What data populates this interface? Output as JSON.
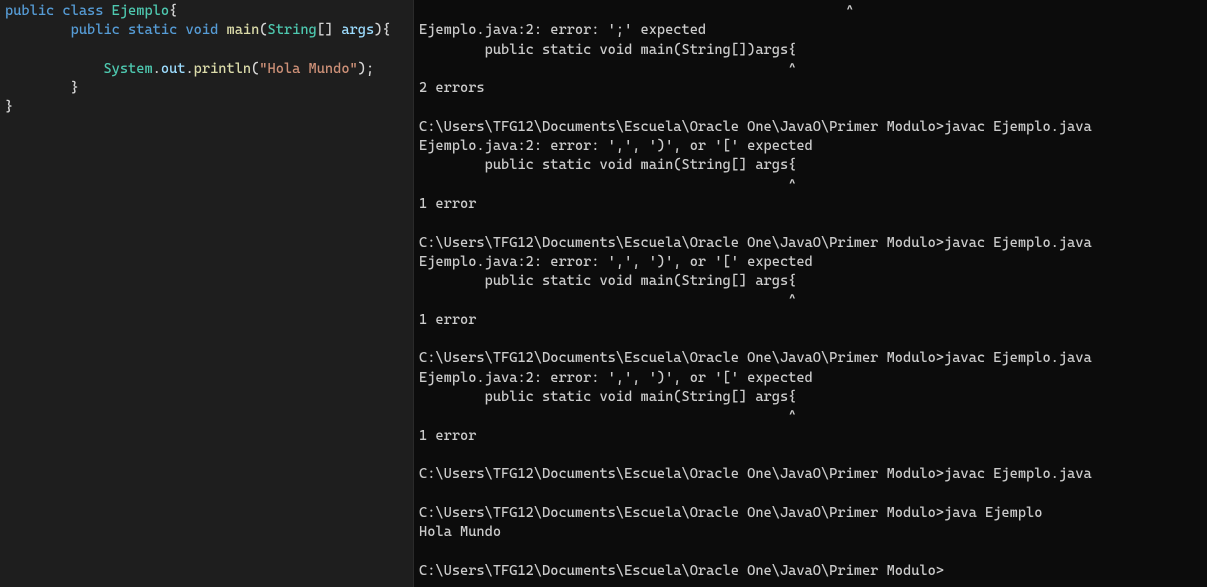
{
  "editor": {
    "tokens": [
      {
        "c": "kw",
        "t": "public"
      },
      {
        "c": "pun",
        "t": " "
      },
      {
        "c": "kw",
        "t": "class"
      },
      {
        "c": "pun",
        "t": " "
      },
      {
        "c": "cls",
        "t": "Ejemplo"
      },
      {
        "c": "pun",
        "t": "{\n"
      },
      {
        "c": "pun",
        "t": "        "
      },
      {
        "c": "kw",
        "t": "public"
      },
      {
        "c": "pun",
        "t": " "
      },
      {
        "c": "kw",
        "t": "static"
      },
      {
        "c": "pun",
        "t": " "
      },
      {
        "c": "kw",
        "t": "void"
      },
      {
        "c": "pun",
        "t": " "
      },
      {
        "c": "fn",
        "t": "main"
      },
      {
        "c": "pun",
        "t": "("
      },
      {
        "c": "type",
        "t": "String"
      },
      {
        "c": "pun",
        "t": "[] "
      },
      {
        "c": "id",
        "t": "args"
      },
      {
        "c": "pun",
        "t": "){\n"
      },
      {
        "c": "pun",
        "t": "\n"
      },
      {
        "c": "pun",
        "t": "            "
      },
      {
        "c": "type",
        "t": "System"
      },
      {
        "c": "pun",
        "t": "."
      },
      {
        "c": "id",
        "t": "out"
      },
      {
        "c": "pun",
        "t": "."
      },
      {
        "c": "fn",
        "t": "println"
      },
      {
        "c": "pun",
        "t": "("
      },
      {
        "c": "str",
        "t": "\"Hola Mundo\""
      },
      {
        "c": "pun",
        "t": ");\n"
      },
      {
        "c": "pun",
        "t": "        }\n"
      },
      {
        "c": "pun",
        "t": "}\n"
      }
    ]
  },
  "terminal": {
    "lines": [
      "                                                    ^",
      "Ejemplo.java:2: error: ';' expected",
      "        public static void main(String[])args{",
      "                                             ^",
      "2 errors",
      "",
      "C:\\Users\\TFG12\\Documents\\Escuela\\Oracle One\\JavaO\\Primer Modulo>javac Ejemplo.java",
      "Ejemplo.java:2: error: ',', ')', or '[' expected",
      "        public static void main(String[] args{",
      "                                             ^",
      "1 error",
      "",
      "C:\\Users\\TFG12\\Documents\\Escuela\\Oracle One\\JavaO\\Primer Modulo>javac Ejemplo.java",
      "Ejemplo.java:2: error: ',', ')', or '[' expected",
      "        public static void main(String[] args{",
      "                                             ^",
      "1 error",
      "",
      "C:\\Users\\TFG12\\Documents\\Escuela\\Oracle One\\JavaO\\Primer Modulo>javac Ejemplo.java",
      "Ejemplo.java:2: error: ',', ')', or '[' expected",
      "        public static void main(String[] args{",
      "                                             ^",
      "1 error",
      "",
      "C:\\Users\\TFG12\\Documents\\Escuela\\Oracle One\\JavaO\\Primer Modulo>javac Ejemplo.java",
      "",
      "C:\\Users\\TFG12\\Documents\\Escuela\\Oracle One\\JavaO\\Primer Modulo>java Ejemplo",
      "Hola Mundo",
      "",
      "C:\\Users\\TFG12\\Documents\\Escuela\\Oracle One\\JavaO\\Primer Modulo>"
    ]
  }
}
